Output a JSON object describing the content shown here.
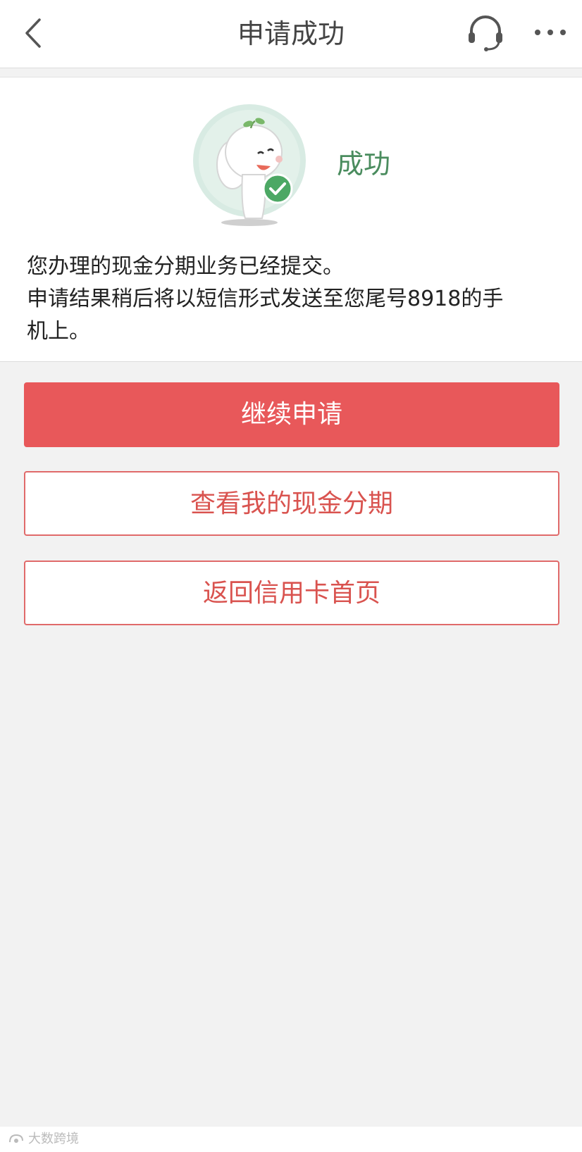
{
  "header": {
    "title": "申请成功",
    "back_icon": "chevron-left-icon",
    "service_icon": "headset-icon",
    "more_icon": "more-icon"
  },
  "result": {
    "status": "成功",
    "message_lines": [
      "您办理的现金分期业务已经提交。",
      "申请结果稍后将以短信形式发送至您尾号8918的手",
      "机上。"
    ]
  },
  "actions": {
    "continue_label": "继续申请",
    "view_label": "查看我的现金分期",
    "home_label": "返回信用卡首页"
  },
  "watermark": {
    "text": "大数跨境"
  },
  "colors": {
    "primary": "#e8585a",
    "success": "#4a8c5e",
    "text": "#222222",
    "background": "#f2f2f2"
  }
}
